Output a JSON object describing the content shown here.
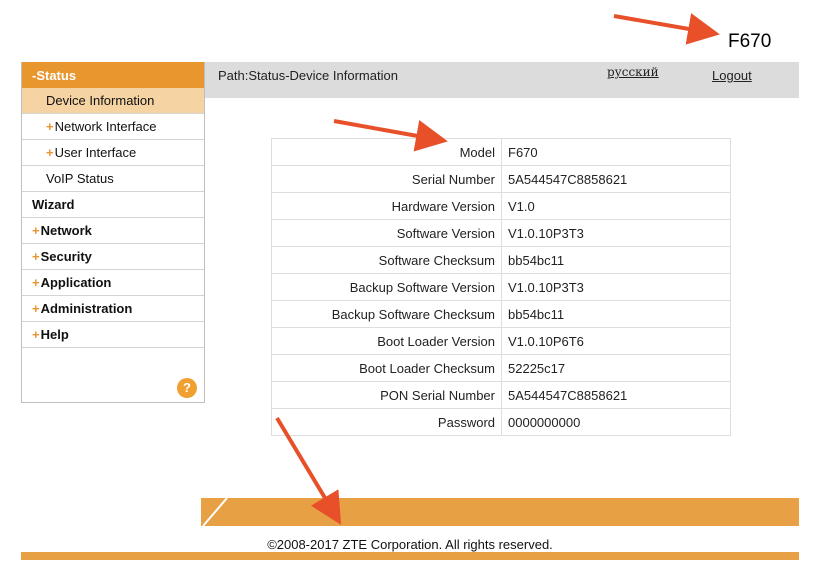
{
  "annotation": {
    "model_heading": "F670"
  },
  "header": {
    "path": "Path:Status-Device Information",
    "language_link": "русский",
    "logout": "Logout"
  },
  "sidebar": {
    "status": "-Status",
    "device_information": "Device Information",
    "network_interface": "Network Interface",
    "user_interface": "User Interface",
    "voip_status": "VoIP Status",
    "wizard": "Wizard",
    "network": "Network",
    "security": "Security",
    "application": "Application",
    "administration": "Administration",
    "help": "Help",
    "plus": "+",
    "help_icon": "?"
  },
  "device_info": [
    {
      "label": "Model",
      "value": "F670"
    },
    {
      "label": "Serial Number",
      "value": "5A544547C8858621"
    },
    {
      "label": "Hardware Version",
      "value": "V1.0"
    },
    {
      "label": "Software Version",
      "value": "V1.0.10P3T3"
    },
    {
      "label": "Software Checksum",
      "value": "bb54bc11"
    },
    {
      "label": "Backup Software Version",
      "value": "V1.0.10P3T3"
    },
    {
      "label": "Backup Software Checksum",
      "value": "bb54bc11"
    },
    {
      "label": "Boot Loader Version",
      "value": "V1.0.10P6T6"
    },
    {
      "label": "Boot Loader Checksum",
      "value": "52225c17"
    },
    {
      "label": "PON Serial Number",
      "value": "5A544547C8858621"
    },
    {
      "label": "Password",
      "value": "0000000000"
    }
  ],
  "footer": {
    "copyright": "©2008-2017 ZTE Corporation. All rights reserved."
  },
  "colors": {
    "accent": "#e8962e",
    "active_bg": "#f5d3a3",
    "arrow": "#e8502a",
    "header_bg": "#dcdcdc"
  }
}
